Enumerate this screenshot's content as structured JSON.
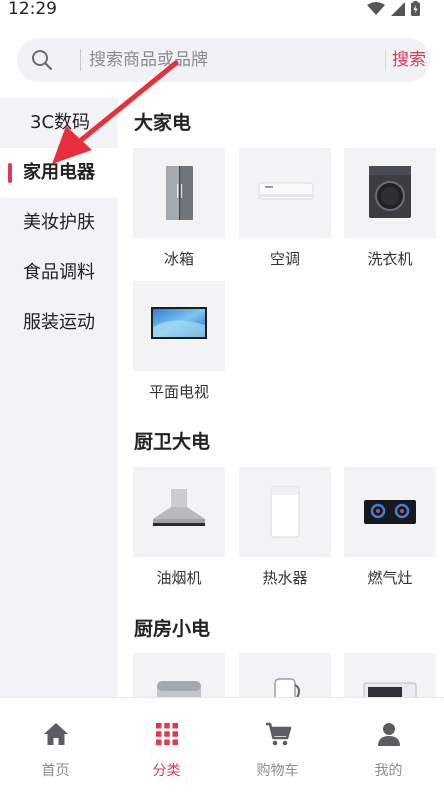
{
  "status_bar": {
    "time": "12:29"
  },
  "search": {
    "placeholder": "搜索商品或品牌",
    "button_label": "搜索"
  },
  "sidebar": {
    "items": [
      {
        "label": "3C数码",
        "active": false
      },
      {
        "label": "家用电器",
        "active": true
      },
      {
        "label": "美妆护肤",
        "active": false
      },
      {
        "label": "食品调料",
        "active": false
      },
      {
        "label": "服装运动",
        "active": false
      }
    ]
  },
  "sections": [
    {
      "title": "大家电",
      "items": [
        {
          "label": "冰箱"
        },
        {
          "label": "空调"
        },
        {
          "label": "洗衣机"
        },
        {
          "label": "平面电视"
        }
      ]
    },
    {
      "title": "厨卫大电",
      "items": [
        {
          "label": "油烟机"
        },
        {
          "label": "热水器"
        },
        {
          "label": "燃气灶"
        }
      ]
    },
    {
      "title": "厨房小电",
      "items": [
        {
          "label": ""
        },
        {
          "label": ""
        },
        {
          "label": ""
        }
      ]
    }
  ],
  "bottom_nav": {
    "items": [
      {
        "label": "首页",
        "icon": "home-icon"
      },
      {
        "label": "分类",
        "icon": "grid-icon",
        "active": true
      },
      {
        "label": "购物车",
        "icon": "cart-icon"
      },
      {
        "label": "我的",
        "icon": "user-icon"
      }
    ]
  },
  "colors": {
    "accent": "#e5374c",
    "sidebar_bg": "#f2f3f7",
    "tile_bg": "#f3f3f5",
    "annotation": "#e8303c"
  }
}
